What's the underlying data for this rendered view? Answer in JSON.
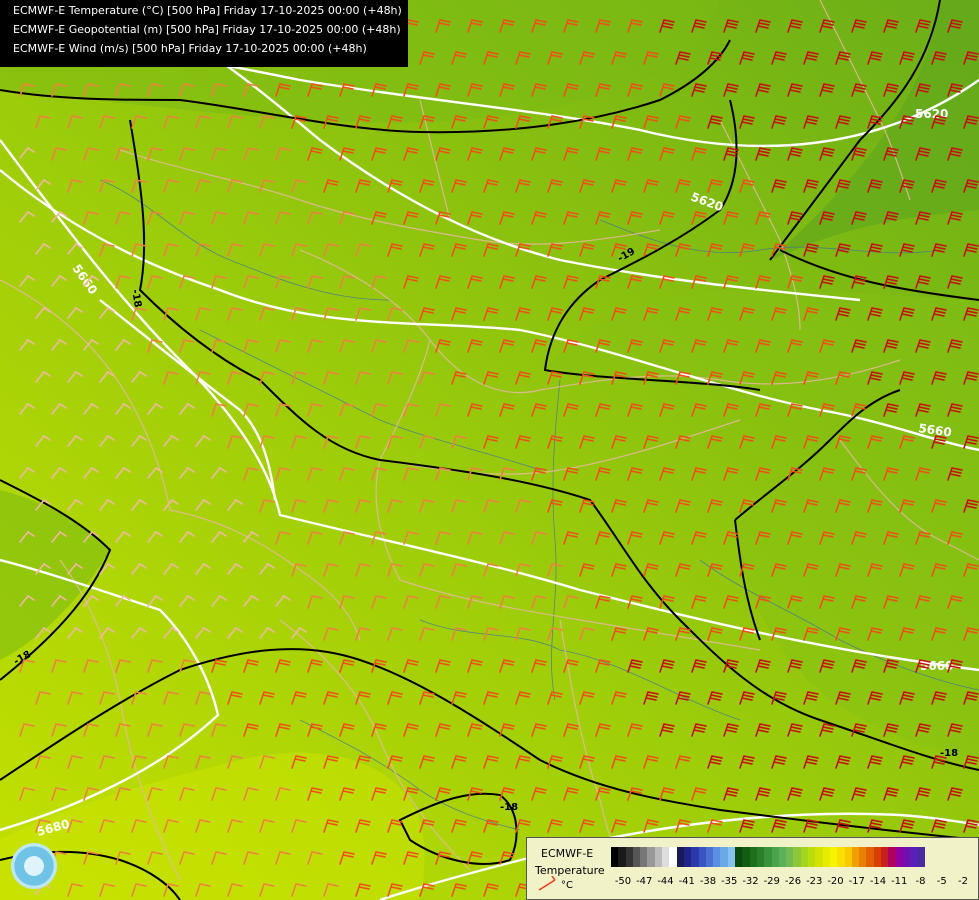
{
  "header": {
    "lines": [
      "ECMWF-E Temperature (°C) [500 hPa] Friday 17-10-2025 00:00 (+48h)",
      "ECMWF-E Geopotential (m) [500 hPa] Friday 17-10-2025 00:00 (+48h)",
      "ECMWF-E Wind (m/s) [500 hPa] Friday 17-10-2025 00:00 (+48h)"
    ]
  },
  "map": {
    "geopotential_labels": [
      "5620",
      "5620",
      "5660",
      "5660",
      "5660",
      "5680"
    ],
    "temperature_labels": [
      "-19",
      "-18",
      "-18",
      "-18",
      "-18"
    ],
    "colors": {
      "contour_geopotential": "#ffffff",
      "contour_temperature": "#000000",
      "borders": "#e8b8a0",
      "rivers": "#3a6aa8"
    }
  },
  "legend": {
    "model": "ECMWF-E",
    "variable": "Temperature",
    "unit": "°C",
    "ticks": [
      "-50",
      "-47",
      "-44",
      "-41",
      "-38",
      "-35",
      "-32",
      "-29",
      "-26",
      "-23",
      "-20",
      "-17",
      "-14",
      "-11",
      "-8",
      "-5",
      "-2"
    ],
    "ramp_colors": [
      "#000000",
      "#1a1a1a",
      "#333333",
      "#555555",
      "#777777",
      "#999999",
      "#bbbbbb",
      "#dddddd",
      "#ffffff",
      "#1a1a5a",
      "#222288",
      "#2a3aa8",
      "#3a55c0",
      "#4a70d0",
      "#5a8ee0",
      "#6aa8e8",
      "#86c2f0",
      "#0a4a0a",
      "#145c14",
      "#1e6e1e",
      "#2a802a",
      "#3a923a",
      "#4aa44a",
      "#5cb05c",
      "#70bc50",
      "#8cc83a",
      "#a4d420",
      "#bcdc10",
      "#d4e400",
      "#e8ec00",
      "#f8f400",
      "#f8e000",
      "#f8c800",
      "#f0a000",
      "#e88000",
      "#e06000",
      "#d84000",
      "#c82020",
      "#b00060",
      "#9000a0",
      "#7010b0",
      "#5a20b8",
      "#4a2aa0"
    ]
  }
}
